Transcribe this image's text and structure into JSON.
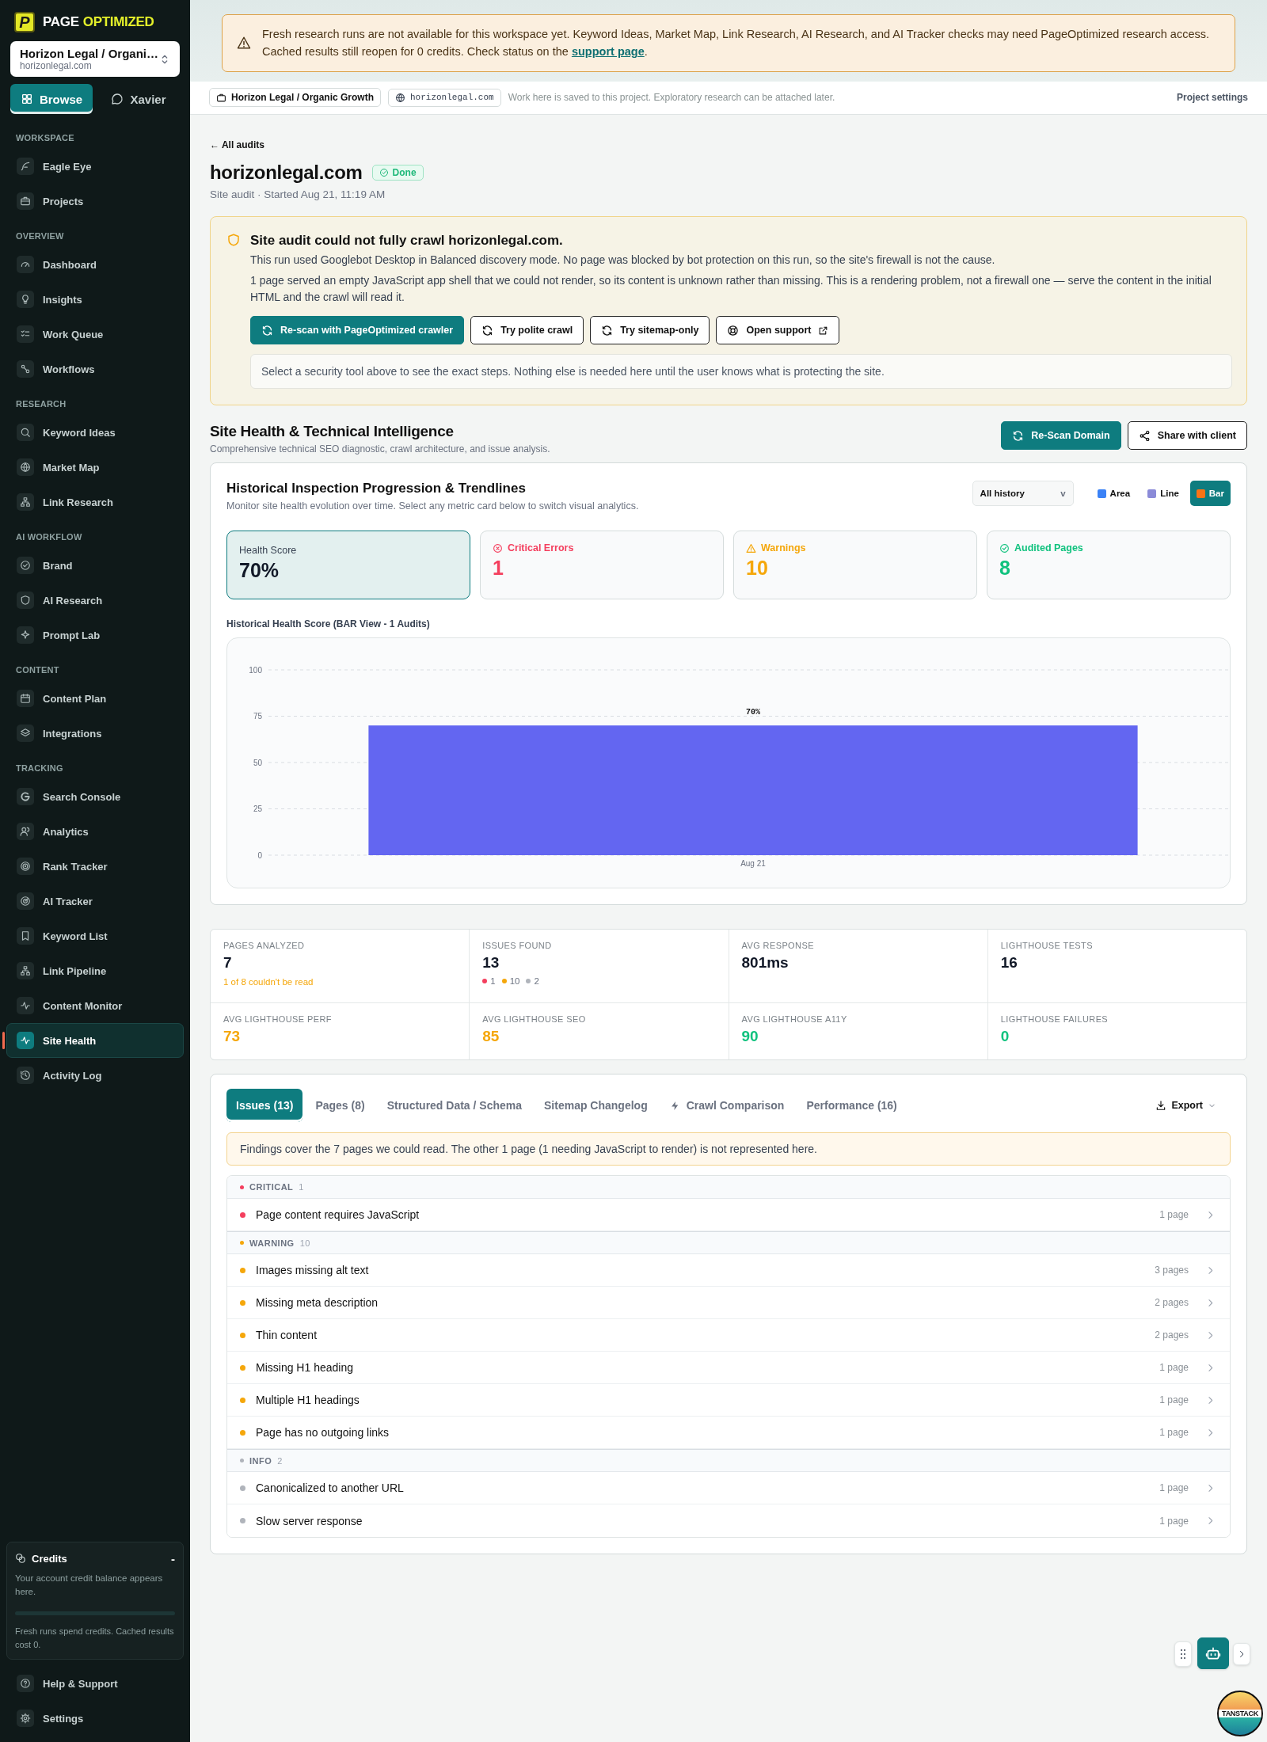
{
  "sidebar": {
    "logo": {
      "mark": "P",
      "word_1": "PAGE",
      "word_2": "OPTIMIZED"
    },
    "project_picker": {
      "name": "Horizon Legal / Organi…",
      "domain": "horizonlegal.com"
    },
    "modes": [
      {
        "label": "Browse",
        "selected": true
      },
      {
        "label": "Xavier",
        "selected": false
      }
    ],
    "sections": [
      {
        "title": "WORKSPACE",
        "items": [
          {
            "label": "Eagle Eye",
            "selected": false
          },
          {
            "label": "Projects",
            "selected": false
          }
        ]
      },
      {
        "title": "OVERVIEW",
        "items": [
          {
            "label": "Dashboard",
            "selected": false
          },
          {
            "label": "Insights",
            "selected": false
          },
          {
            "label": "Work Queue",
            "selected": false
          },
          {
            "label": "Workflows",
            "selected": false
          }
        ]
      },
      {
        "title": "RESEARCH",
        "items": [
          {
            "label": "Keyword Ideas",
            "selected": false
          },
          {
            "label": "Market Map",
            "selected": false
          },
          {
            "label": "Link Research",
            "selected": false
          }
        ]
      },
      {
        "title": "AI WORKFLOW",
        "items": [
          {
            "label": "Brand",
            "selected": false
          },
          {
            "label": "AI Research",
            "selected": false
          },
          {
            "label": "Prompt Lab",
            "selected": false
          }
        ]
      },
      {
        "title": "CONTENT",
        "items": [
          {
            "label": "Content Plan",
            "selected": false
          },
          {
            "label": "Integrations",
            "selected": false
          }
        ]
      },
      {
        "title": "TRACKING",
        "items": [
          {
            "label": "Search Console",
            "selected": false
          },
          {
            "label": "Analytics",
            "selected": false
          },
          {
            "label": "Rank Tracker",
            "selected": false
          },
          {
            "label": "AI Tracker",
            "selected": false
          },
          {
            "label": "Keyword List",
            "selected": false
          },
          {
            "label": "Link Pipeline",
            "selected": false
          },
          {
            "label": "Content Monitor",
            "selected": false
          },
          {
            "label": "Site Health",
            "selected": true
          },
          {
            "label": "Activity Log",
            "selected": false
          }
        ]
      }
    ],
    "credits": {
      "title": "Credits",
      "toggle": "-",
      "text": "Your account credit balance appears here.",
      "level": 0,
      "note": "Fresh runs spend credits. Cached results cost 0."
    },
    "footer_items": [
      {
        "label": "Help & Support"
      },
      {
        "label": "Settings"
      }
    ]
  },
  "banner": {
    "text": "Fresh research runs are not available for this workspace yet. Keyword Ideas, Market Map, Link Research, AI Research, and AI Tracker checks may need PageOptimized research access. Cached results still reopen for 0 credits. Check status on the ",
    "link": "support page",
    "text_end": "."
  },
  "project_bar": {
    "project": "Horizon Legal / Organic Growth",
    "domain": "horizonlegal.com",
    "note": "Work here is saved to this project. Exploratory research can be attached later.",
    "settings": "Project settings"
  },
  "audit": {
    "back": "← All audits",
    "title": "horizonlegal.com",
    "status": "Done",
    "subtitle": "Site audit · Started Aug 21, 11:19 AM"
  },
  "crawl_alert": {
    "title": "Site audit could not fully crawl horizonlegal.com.",
    "paragraphs": [
      "This run used Googlebot Desktop in Balanced discovery mode. No page was blocked by bot protection on this run, so the site's firewall is not the cause.",
      "1 page served an empty JavaScript app shell that we could not render, so its content is unknown rather than missing. This is a rendering problem, not a firewall one — serve the content in the initial HTML and the crawl will read it."
    ],
    "actions": [
      {
        "label": "Re-scan with PageOptimized crawler",
        "kind": "primary"
      },
      {
        "label": "Try polite crawl",
        "kind": "secondary"
      },
      {
        "label": "Try sitemap-only",
        "kind": "secondary"
      },
      {
        "label": "Open support",
        "kind": "external"
      }
    ],
    "hint": "Select a security tool above to see the exact steps. Nothing else is needed here until the user knows what is protecting the site."
  },
  "site_health": {
    "title": "Site Health & Technical Intelligence",
    "subtitle": "Comprehensive technical SEO diagnostic, crawl architecture, and issue analysis.",
    "actions": [
      {
        "label": "Re-Scan Domain",
        "kind": "primary"
      },
      {
        "label": "Share with client",
        "kind": "secondary"
      }
    ],
    "history": {
      "title": "Historical Inspection Progression & Trendlines",
      "subtitle": "Monitor site health evolution over time. Select any metric card below to switch visual analytics.",
      "range": "All history",
      "range_caret": "v",
      "views": [
        {
          "label": "Area",
          "selected": false
        },
        {
          "label": "Line",
          "selected": false
        },
        {
          "label": "Bar",
          "selected": true
        }
      ],
      "metrics": [
        {
          "kind": "score",
          "label": "Health Score",
          "value": "70%",
          "selected": true,
          "color": "#111827"
        },
        {
          "kind": "error",
          "label": "Critical Errors",
          "value": "1",
          "selected": false,
          "color": "#f43f5e"
        },
        {
          "kind": "warning",
          "label": "Warnings",
          "value": "10",
          "selected": false,
          "color": "#f5a70b"
        },
        {
          "kind": "success",
          "label": "Audited Pages",
          "value": "8",
          "selected": false,
          "color": "#10c27e"
        }
      ],
      "chart_title": "Historical Health Score (BAR View - 1 Audits)",
      "chart_data": {
        "type": "bar",
        "categories": [
          "Aug 21"
        ],
        "values": [
          70
        ],
        "ylim": [
          0,
          100
        ],
        "grid": true,
        "yticks": [
          0,
          25,
          50,
          75,
          100
        ],
        "value_labels": [
          "70%"
        ]
      }
    }
  },
  "stats": [
    {
      "label": "PAGES ANALYZED",
      "value": "7",
      "color": "#111827",
      "note": "1 of 8 couldn't be read"
    },
    {
      "label": "ISSUES FOUND",
      "value": "13",
      "color": "#111827",
      "breakdown": [
        {
          "count": "1",
          "color": "#f43f5e"
        },
        {
          "count": "10",
          "color": "#f5a70b"
        },
        {
          "count": "2",
          "color": "#b0b4bb"
        }
      ]
    },
    {
      "label": "AVG RESPONSE",
      "value": "801ms",
      "color": "#111827"
    },
    {
      "label": "LIGHTHOUSE TESTS",
      "value": "16",
      "color": "#111827"
    },
    {
      "label": "AVG LIGHTHOUSE PERF",
      "value": "73",
      "color": "#f5a70b"
    },
    {
      "label": "AVG LIGHTHOUSE SEO",
      "value": "85",
      "color": "#f5a70b"
    },
    {
      "label": "AVG LIGHTHOUSE A11Y",
      "value": "90",
      "color": "#10c27e"
    },
    {
      "label": "LIGHTHOUSE FAILURES",
      "value": "0",
      "color": "#10c27e"
    }
  ],
  "issues_panel": {
    "tabs": [
      {
        "label": "Issues (13)",
        "kind": "plain",
        "selected": true
      },
      {
        "label": "Pages (8)",
        "kind": "plain",
        "selected": false
      },
      {
        "label": "Structured Data / Schema",
        "kind": "plain",
        "selected": false
      },
      {
        "label": "Sitemap Changelog",
        "kind": "plain",
        "selected": false
      },
      {
        "label": "Crawl Comparison",
        "kind": "bolt",
        "selected": false
      },
      {
        "label": "Performance (16)",
        "kind": "plain",
        "selected": false
      }
    ],
    "export": "Export",
    "notice": "Findings cover the 7 pages we could read. The other 1 page (1 needing JavaScript to render) is not represented here.",
    "groups": [
      {
        "severity": "CRITICAL",
        "count": "1",
        "color": "#f43f5e",
        "items": [
          {
            "label": "Page content requires JavaScript",
            "pages": "1 page"
          }
        ]
      },
      {
        "severity": "WARNING",
        "count": "10",
        "color": "#f5a70b",
        "items": [
          {
            "label": "Images missing alt text",
            "pages": "3 pages"
          },
          {
            "label": "Missing meta description",
            "pages": "2 pages"
          },
          {
            "label": "Thin content",
            "pages": "2 pages"
          },
          {
            "label": "Missing H1 heading",
            "pages": "1 page"
          },
          {
            "label": "Multiple H1 headings",
            "pages": "1 page"
          },
          {
            "label": "Page has no outgoing links",
            "pages": "1 page"
          }
        ]
      },
      {
        "severity": "INFO",
        "count": "2",
        "color": "#b0b4bb",
        "items": [
          {
            "label": "Canonicalized to another URL",
            "pages": "1 page"
          },
          {
            "label": "Slow server response",
            "pages": "1 page"
          }
        ]
      }
    ]
  },
  "tanstack_badge": {
    "label": "TANSTACK"
  }
}
